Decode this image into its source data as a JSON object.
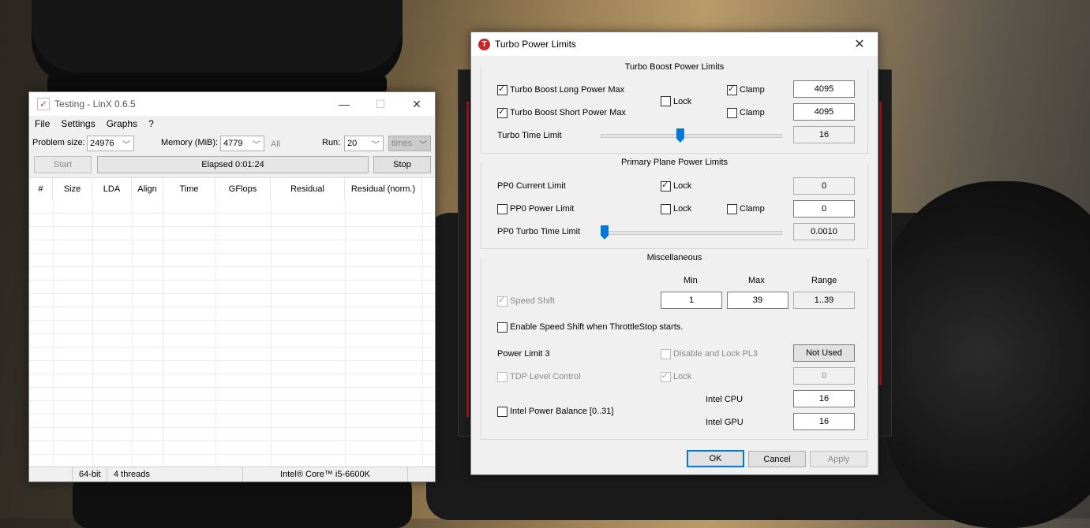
{
  "linx": {
    "title": "Testing - LinX 0.6.5",
    "menu": [
      "File",
      "Settings",
      "Graphs",
      "?"
    ],
    "problem_size_label": "Problem size:",
    "problem_size": "24976",
    "memory_label": "Memory (MiB):",
    "memory": "4779",
    "all_label": "All",
    "run_label": "Run:",
    "run": "20",
    "run_unit": "times",
    "start_label": "Start",
    "elapsed": "Elapsed 0:01:24",
    "stop_label": "Stop",
    "columns": [
      "#",
      "Size",
      "LDA",
      "Align",
      "Time",
      "GFlops",
      "Residual",
      "Residual (norm.)"
    ],
    "status": {
      "bits": "64-bit",
      "threads": "4 threads",
      "cpu": "Intel® Core™ i5-6600K"
    }
  },
  "tpl": {
    "title": "Turbo Power Limits",
    "turbo_group": "Turbo Boost Power Limits",
    "long_power_label": "Turbo Boost Long Power Max",
    "long_power_value": "4095",
    "short_power_label": "Turbo Boost Short Power Max",
    "short_power_value": "4095",
    "lock_label": "Lock",
    "clamp_label": "Clamp",
    "turbo_time_label": "Turbo Time Limit",
    "turbo_time_value": "16",
    "pp0_group": "Primary Plane Power Limits",
    "pp0_current_label": "PP0 Current Limit",
    "pp0_current_value": "0",
    "pp0_power_label": "PP0 Power Limit",
    "pp0_power_value": "0",
    "pp0_turbo_time_label": "PP0 Turbo Time Limit",
    "pp0_turbo_time_value": "0.0010",
    "misc_group": "Miscellaneous",
    "min_label": "Min",
    "max_label": "Max",
    "range_label": "Range",
    "speed_shift_label": "Speed Shift",
    "speed_shift_min": "1",
    "speed_shift_max": "39",
    "speed_shift_range": "1..39",
    "enable_speed_shift_label": "Enable Speed Shift when ThrottleStop starts.",
    "pl3_label": "Power Limit 3",
    "disable_pl3_label": "Disable and Lock PL3",
    "pl3_value": "Not Used",
    "tdp_label": "TDP Level Control",
    "tdp_value": "0",
    "power_balance_label": "Intel Power Balance  [0..31]",
    "cpu_label": "Intel CPU",
    "cpu_value": "16",
    "gpu_label": "Intel GPU",
    "gpu_value": "16",
    "ok_label": "OK",
    "cancel_label": "Cancel",
    "apply_label": "Apply",
    "turbo_time_slider_fraction": 0.44,
    "pp0_slider_fraction": 0.0
  }
}
